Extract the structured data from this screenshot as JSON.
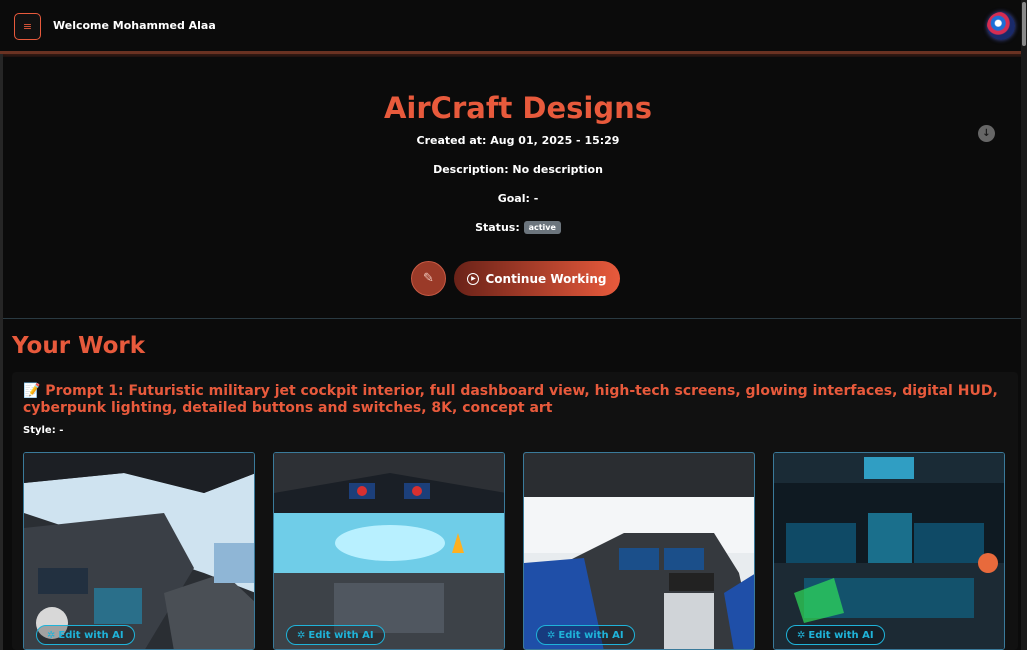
{
  "header": {
    "menu_icon": "hamburger-icon",
    "welcome": "Welcome Mohammed Alaa",
    "logo_icon": "swirl-logo"
  },
  "project": {
    "title": "AirCraft Designs",
    "created_label": "Created at: Aug 01, 2025 - 15:29",
    "description_label": "Description: No description",
    "goal_label": "Goal: -",
    "status_label": "Status:",
    "status_value": "active",
    "edit_icon": "pencil-icon",
    "continue_label": "Continue Working",
    "download_icon": "arrow-down-circle-icon"
  },
  "work": {
    "title": "Your Work",
    "prompts": [
      {
        "prompt_title": "📝 Prompt 1: Futuristic military jet cockpit interior, full dashboard view, high-tech screens, glowing interfaces, digital HUD, cyberpunk lighting, detailed buttons and switches, 8K, concept art",
        "style_label": "Style: -",
        "images": [
          {
            "edit_label": "Edit with AI"
          },
          {
            "edit_label": "Edit with AI"
          },
          {
            "edit_label": "Edit with AI"
          },
          {
            "edit_label": "Edit with AI"
          }
        ]
      }
    ]
  },
  "colors": {
    "accent": "#e85a3c",
    "cyan": "#1fb3d9",
    "badge": "#6c757d"
  }
}
